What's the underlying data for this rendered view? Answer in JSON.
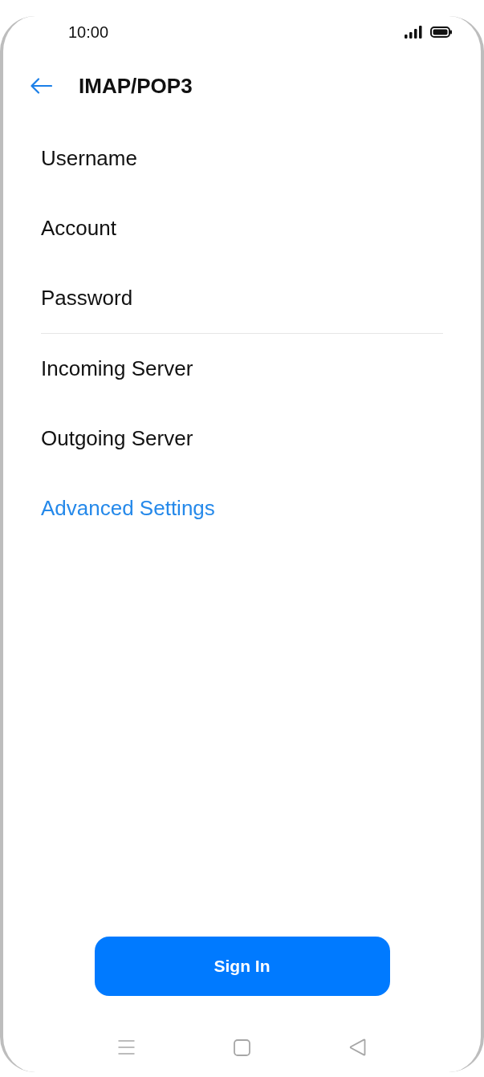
{
  "status_bar": {
    "time": "10:00"
  },
  "header": {
    "title": "IMAP/POP3"
  },
  "field_groups": [
    {
      "fields": [
        {
          "placeholder": "Username"
        },
        {
          "placeholder": "Account"
        },
        {
          "placeholder": "Password"
        }
      ]
    },
    {
      "fields": [
        {
          "placeholder": "Incoming Server"
        },
        {
          "placeholder": "Outgoing Server"
        }
      ]
    }
  ],
  "advanced_link": "Advanced Settings",
  "primary_button": "Sign In"
}
